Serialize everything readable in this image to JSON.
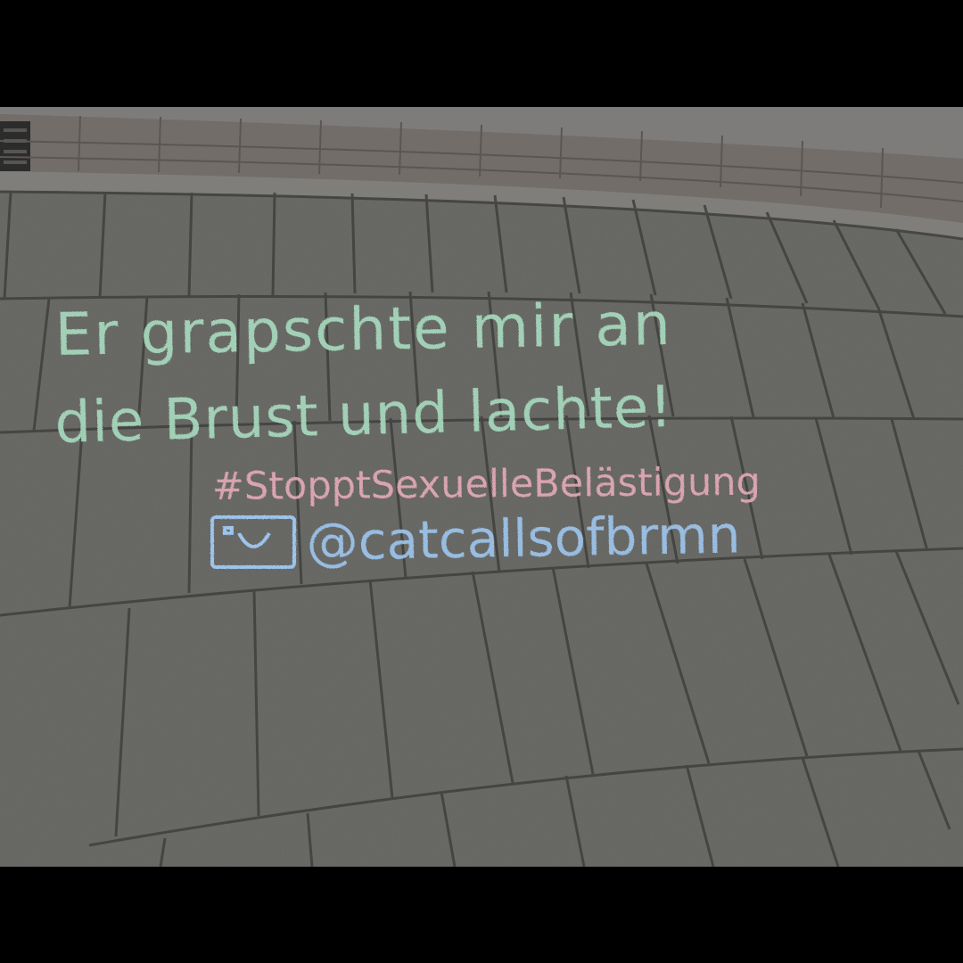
{
  "chalk_message": {
    "line1": "Er grapschte mir an",
    "line2": "die Brust und lachte!",
    "hashtag": "#StopptSexuelleBelästigung",
    "handle": "@catcallsofbrmn",
    "handle_icon": "instagram-icon"
  },
  "colors": {
    "frame": "#000000",
    "pavement": "#6c6c69",
    "curb": "#7a7977",
    "brick_strip": "#76706c",
    "joints": "#3f3f3d",
    "chalk_green": "#a9dcbf",
    "chalk_pink": "#e3a9b6",
    "chalk_blue": "#9cc4ec"
  }
}
